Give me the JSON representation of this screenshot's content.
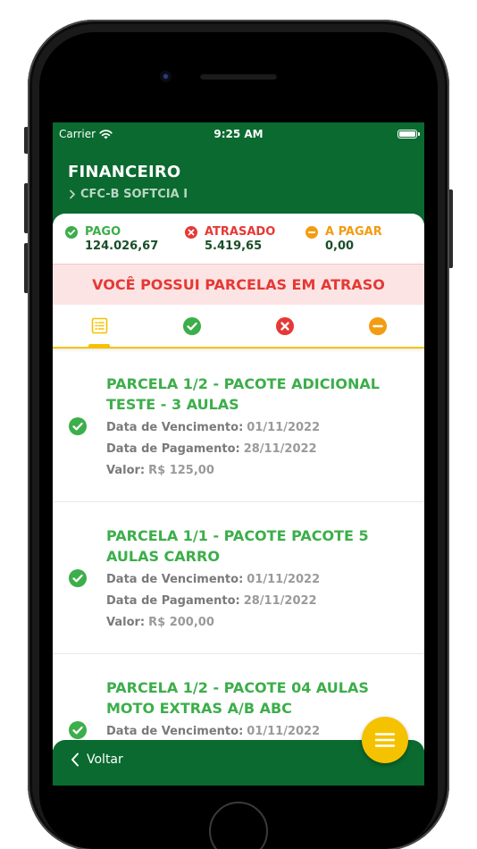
{
  "status_bar": {
    "carrier": "Carrier",
    "time": "9:25 AM"
  },
  "header": {
    "title": "FINANCEIRO",
    "subtitle": "CFC-B SOFTCIA I"
  },
  "summary": {
    "paid": {
      "label": "PAGO",
      "value": "124.026,67",
      "color": "#3cae4a"
    },
    "late": {
      "label": "ATRASADO",
      "value": "5.419,65",
      "color": "#e53935"
    },
    "to_pay": {
      "label": "A PAGAR",
      "value": "0,00",
      "color": "#f39c12"
    }
  },
  "alert": {
    "text": "VOCÊ POSSUI PARCELAS EM ATRASO"
  },
  "tabs": [
    {
      "icon": "list-icon",
      "active": true
    },
    {
      "icon": "check-circle-icon",
      "active": false
    },
    {
      "icon": "x-circle-icon",
      "active": false
    },
    {
      "icon": "minus-circle-icon",
      "active": false
    }
  ],
  "labels": {
    "due_date": "Data de Vencimento:",
    "payment_date": "Data de Pagamento:",
    "amount": "Valor:"
  },
  "installments": [
    {
      "title": "PARCELA 1/2 - PACOTE ADICIONAL TESTE - 3 AULAS",
      "due_date": "01/11/2022",
      "payment_date": "28/11/2022",
      "amount": "R$ 125,00",
      "status": "paid"
    },
    {
      "title": "PARCELA 1/1 - PACOTE PACOTE 5 AULAS CARRO",
      "due_date": "01/11/2022",
      "payment_date": "28/11/2022",
      "amount": "R$ 200,00",
      "status": "paid"
    },
    {
      "title": "PARCELA 1/2 - PACOTE 04 AULAS MOTO EXTRAS A/B ABC",
      "due_date": "01/11/2022",
      "status": "paid"
    }
  ],
  "bottom_bar": {
    "back_label": "Voltar"
  },
  "colors": {
    "brand_green": "#0a6a2f",
    "accent_yellow": "#f5c200"
  }
}
